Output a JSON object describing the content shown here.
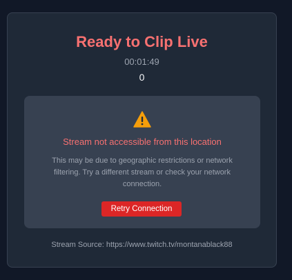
{
  "header": {
    "title": "Ready to Clip Live",
    "timer": "00:01:49",
    "count": "0"
  },
  "error_panel": {
    "icon": "warning-icon",
    "message": "Stream not accessible from this location",
    "detail": "This may be due to geographic restrictions or network filtering. Try a different stream or check your network connection.",
    "retry_label": "Retry Connection"
  },
  "footer": {
    "source": "Stream Source: https://www.twitch.tv/montanablack88"
  },
  "colors": {
    "accent": "#f87171",
    "button": "#dc2626",
    "warning": "#f59e0b"
  }
}
